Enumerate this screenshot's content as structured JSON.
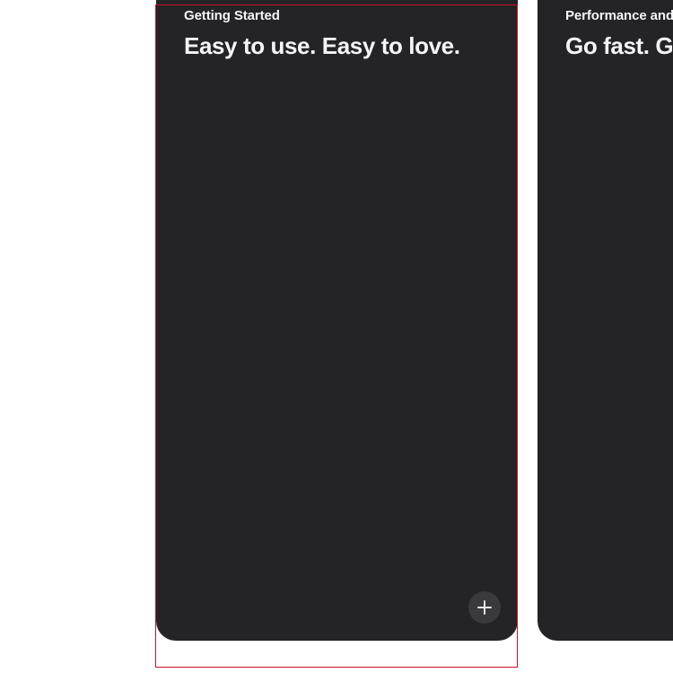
{
  "cards": [
    {
      "eyebrow": "Getting Started",
      "headline": "Easy to use. Easy to love.",
      "action_icon": "plus-icon"
    },
    {
      "eyebrow": "Performance and Battery Life",
      "headline": "Go fast. Go far.",
      "action_icon": "plus-icon"
    }
  ],
  "colors": {
    "card_background": "#242426",
    "card_text": "#f5f5f7",
    "button_background": "#3a3a3c",
    "focus_outline": "#c8102e",
    "page_background": "#ffffff"
  }
}
